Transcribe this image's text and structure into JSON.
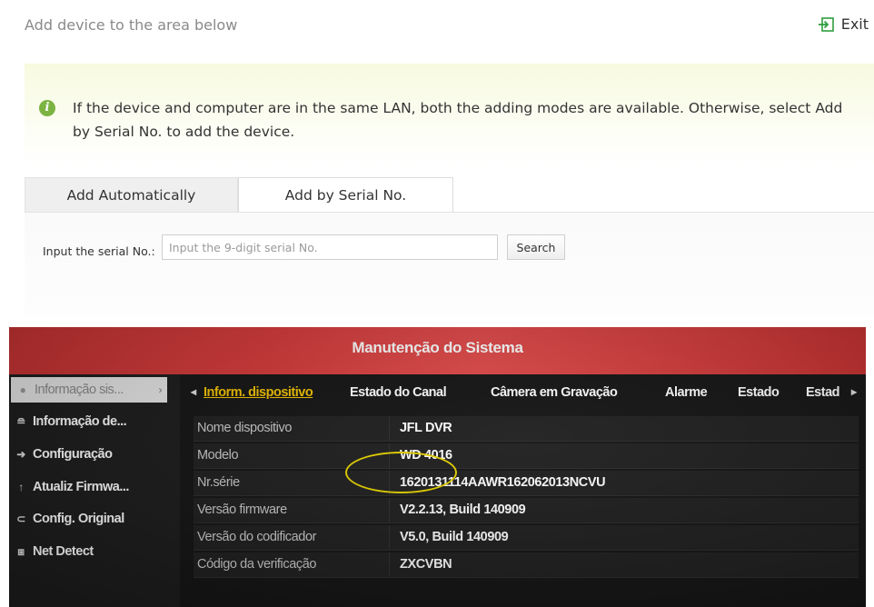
{
  "header": {
    "title": "Add device to the area below",
    "exit_label": "Exit"
  },
  "notice": {
    "icon": "info-icon",
    "text": "If the device and computer are in the same LAN, both the adding modes are available. Otherwise, select Add by Serial No. to add the device."
  },
  "tabs": [
    {
      "label": "Add Automatically",
      "active": false
    },
    {
      "label": "Add by Serial No.",
      "active": true
    }
  ],
  "serial_form": {
    "label": "Input the serial No.:",
    "placeholder": "Input the 9-digit serial No.",
    "value": "",
    "search_label": "Search"
  },
  "dvr_screen": {
    "title": "Manutenção do Sistema",
    "sidebar": [
      {
        "label": "Informação sis...",
        "icon": "info-dot-icon",
        "active": true
      },
      {
        "label": "Informação de...",
        "icon": "log-icon",
        "active": false
      },
      {
        "label": "Configuração",
        "icon": "arrow-icon",
        "active": false
      },
      {
        "label": "Atualiz Firmwa...",
        "icon": "upgrade-arrow-icon",
        "active": false
      },
      {
        "label": "Config. Original",
        "icon": "reset-icon",
        "active": false
      },
      {
        "label": "Net Detect",
        "icon": "network-icon",
        "active": false
      }
    ],
    "tabs": [
      "Inform. dispositivo",
      "Estado do Canal",
      "Câmera em Gravação",
      "Alarme",
      "Estado",
      "Estad"
    ],
    "active_tab": "Inform. dispositivo",
    "active_tab_color": "#f2c200",
    "title_bar_color": "#d63a3a",
    "rows": [
      {
        "label": "Nome dispositivo",
        "value": "JFL DVR"
      },
      {
        "label": "Modelo",
        "value": "WD 4016"
      },
      {
        "label": "Nr.série",
        "value": "1620131114AAWR162062013NCVU"
      },
      {
        "label": "Versão firmware",
        "value": "V2.2.13, Build 140909"
      },
      {
        "label": "Versão do codificador",
        "value": "V5.0, Build 140909"
      },
      {
        "label": "Código da verificação",
        "value": "ZXCVBN"
      }
    ],
    "highlight_color": "#e6d200"
  }
}
